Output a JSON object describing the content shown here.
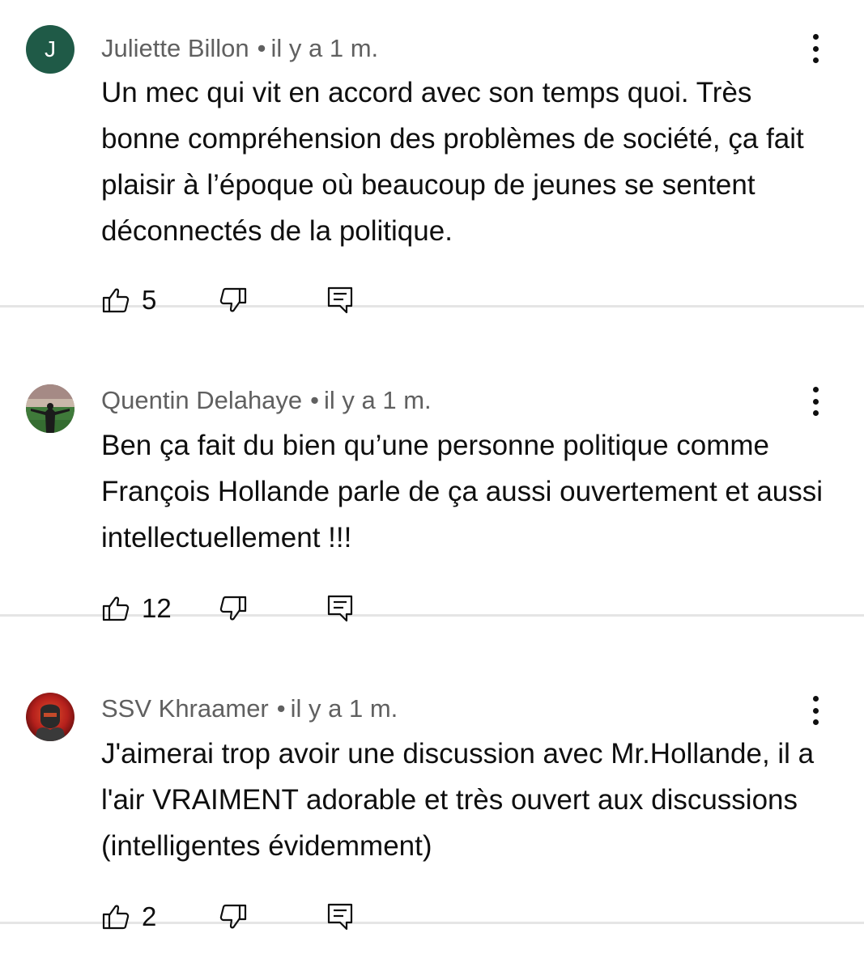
{
  "comments": [
    {
      "author": "Juliette Billon",
      "separator": "•",
      "time": "il y a 1 m.",
      "avatar_letter": "J",
      "avatar_color": "#1f5a47",
      "text": "Un mec qui vit en accord avec son temps quoi. Très bonne compréhension des problèmes de société, ça fait plaisir à l’époque où beaucoup de jeunes se sentent déconnectés de la politique.",
      "likes": "5"
    },
    {
      "author": "Quentin Delahaye",
      "separator": "•",
      "time": "il y a 1 m.",
      "avatar_letter": "",
      "text": "Ben ça fait du bien qu’une personne politique comme François Hollande parle de ça aussi ouvertement et aussi intellectuellement !!!",
      "likes": "12"
    },
    {
      "author": "SSV Khraamer",
      "separator": "•",
      "time": "il y a 1 m.",
      "avatar_letter": "",
      "text": "J'aimerai trop avoir une discussion avec Mr.Hollande, il a l'air VRAIMENT adorable et très ouvert aux discussions (intelligentes évidemment)",
      "likes": "2"
    }
  ],
  "icons": {
    "like": "thumbs-up-icon",
    "dislike": "thumbs-down-icon",
    "reply": "reply-comment-icon",
    "menu": "more-vertical-icon"
  },
  "colors": {
    "meta_text": "#606060",
    "body_text": "#0f0f0f",
    "divider": "#e5e5e5"
  }
}
